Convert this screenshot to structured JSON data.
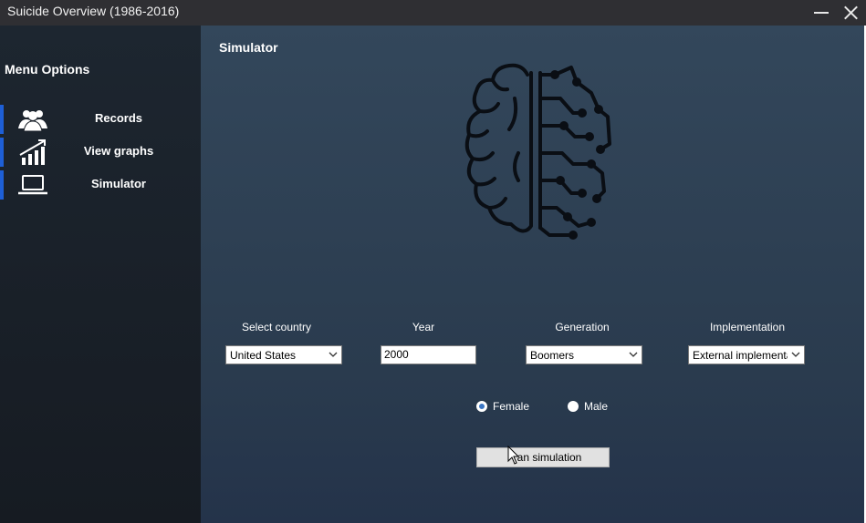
{
  "window": {
    "title": "Suicide Overview (1986-2016)"
  },
  "sidebar": {
    "title": "Menu Options",
    "items": [
      {
        "label": "Records",
        "icon": "users-icon"
      },
      {
        "label": "View graphs",
        "icon": "chart-icon"
      },
      {
        "label": "Simulator",
        "icon": "laptop-icon"
      }
    ]
  },
  "main": {
    "title": "Simulator",
    "fields": {
      "country": {
        "label": "Select country",
        "value": "United States"
      },
      "year": {
        "label": "Year",
        "value": "2000"
      },
      "generation": {
        "label": "Generation",
        "value": "Boomers"
      },
      "implementation": {
        "label": "Implementation",
        "value": "External implementat"
      }
    },
    "gender": {
      "female": "Female",
      "male": "Male",
      "selected": "Female"
    },
    "run_button": "Run simulation",
    "run_button_visible": "an simulation"
  },
  "colors": {
    "accent": "#1e5fd6",
    "sidebar": "#1b2129",
    "main": "#33475b"
  }
}
